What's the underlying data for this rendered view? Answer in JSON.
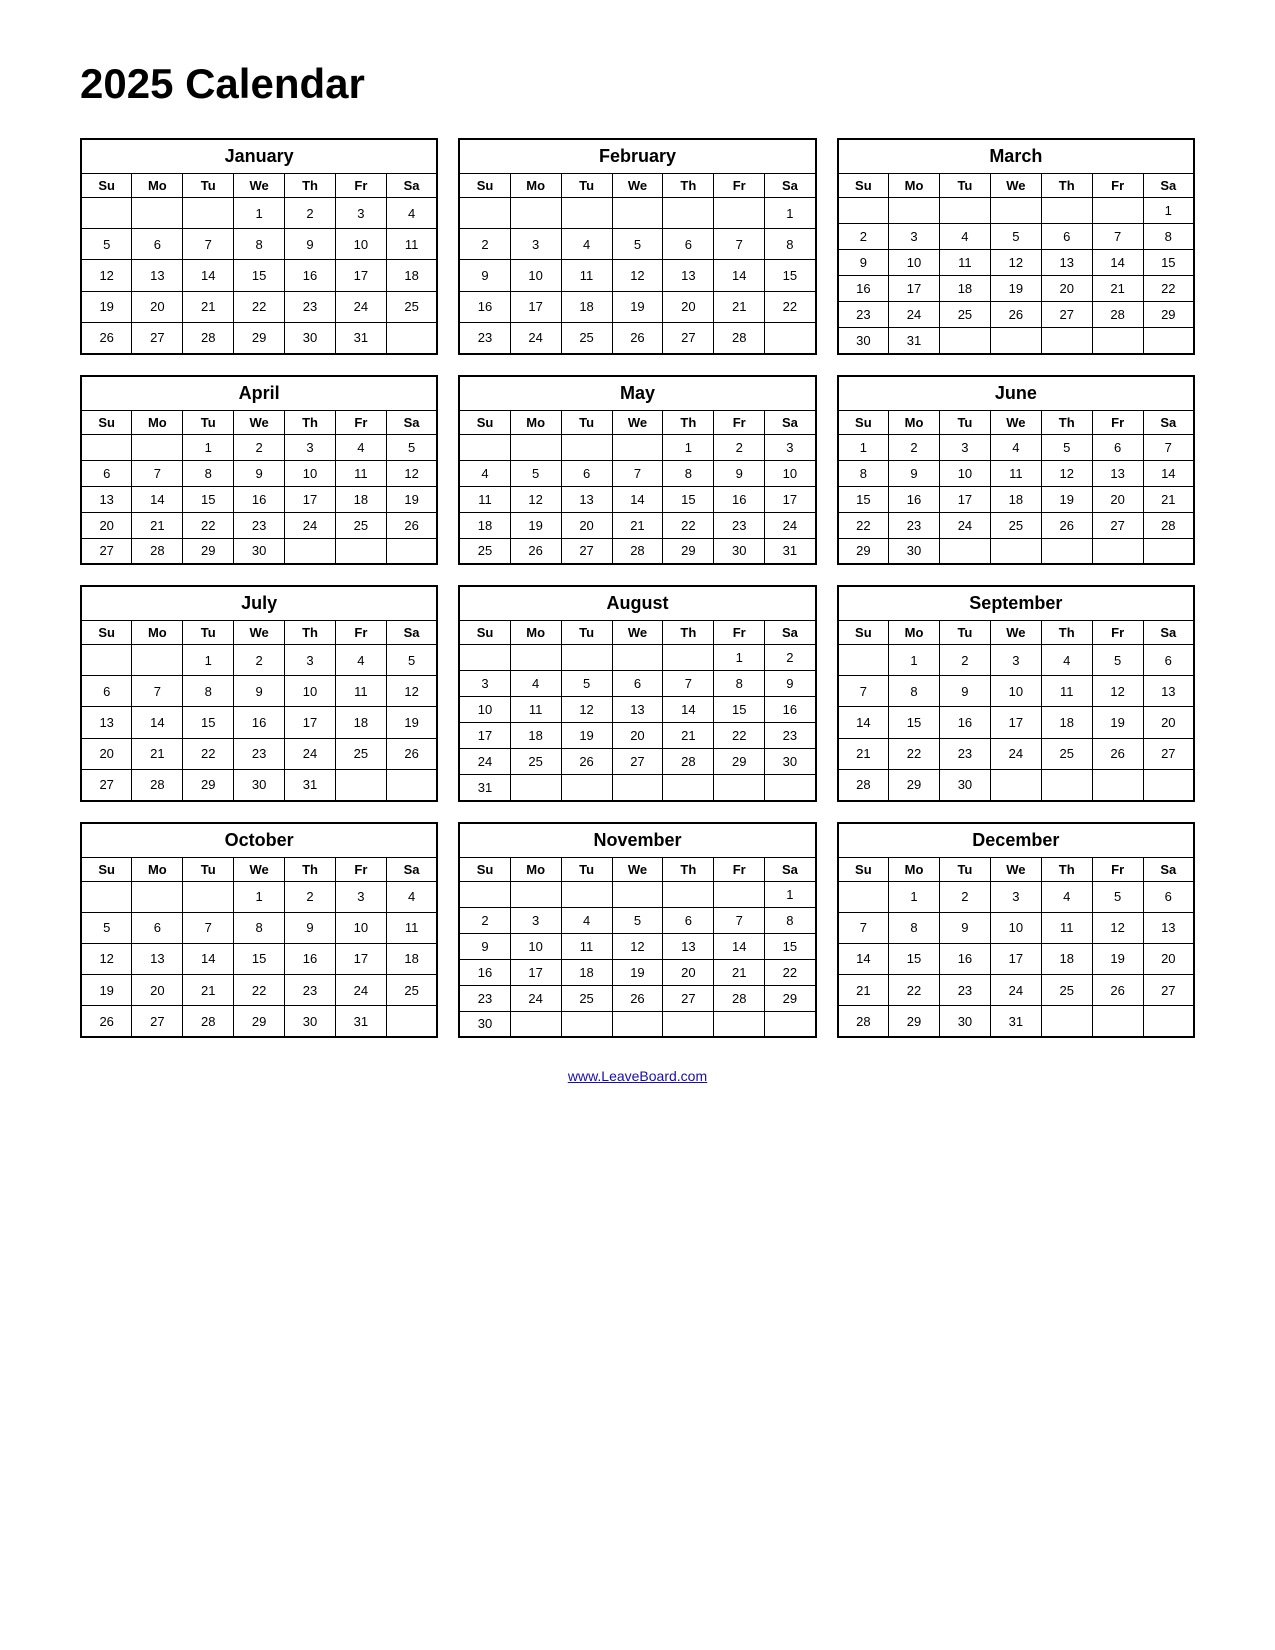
{
  "title": "2025 Calendar",
  "footer_link": "www.LeaveBoard.com",
  "days_header": [
    "Su",
    "Mo",
    "Tu",
    "We",
    "Th",
    "Fr",
    "Sa"
  ],
  "months": [
    {
      "name": "January",
      "weeks": [
        [
          "",
          "",
          "",
          "1",
          "2",
          "3",
          "4"
        ],
        [
          "5",
          "6",
          "7",
          "8",
          "9",
          "10",
          "11"
        ],
        [
          "12",
          "13",
          "14",
          "15",
          "16",
          "17",
          "18"
        ],
        [
          "19",
          "20",
          "21",
          "22",
          "23",
          "24",
          "25"
        ],
        [
          "26",
          "27",
          "28",
          "29",
          "30",
          "31",
          ""
        ]
      ]
    },
    {
      "name": "February",
      "weeks": [
        [
          "",
          "",
          "",
          "",
          "",
          "",
          "1"
        ],
        [
          "2",
          "3",
          "4",
          "5",
          "6",
          "7",
          "8"
        ],
        [
          "9",
          "10",
          "11",
          "12",
          "13",
          "14",
          "15"
        ],
        [
          "16",
          "17",
          "18",
          "19",
          "20",
          "21",
          "22"
        ],
        [
          "23",
          "24",
          "25",
          "26",
          "27",
          "28",
          ""
        ]
      ]
    },
    {
      "name": "March",
      "weeks": [
        [
          "",
          "",
          "",
          "",
          "",
          "",
          "1"
        ],
        [
          "2",
          "3",
          "4",
          "5",
          "6",
          "7",
          "8"
        ],
        [
          "9",
          "10",
          "11",
          "12",
          "13",
          "14",
          "15"
        ],
        [
          "16",
          "17",
          "18",
          "19",
          "20",
          "21",
          "22"
        ],
        [
          "23",
          "24",
          "25",
          "26",
          "27",
          "28",
          "29"
        ],
        [
          "30",
          "31",
          "",
          "",
          "",
          "",
          ""
        ]
      ]
    },
    {
      "name": "April",
      "weeks": [
        [
          "",
          "",
          "1",
          "2",
          "3",
          "4",
          "5"
        ],
        [
          "6",
          "7",
          "8",
          "9",
          "10",
          "11",
          "12"
        ],
        [
          "13",
          "14",
          "15",
          "16",
          "17",
          "18",
          "19"
        ],
        [
          "20",
          "21",
          "22",
          "23",
          "24",
          "25",
          "26"
        ],
        [
          "27",
          "28",
          "29",
          "30",
          "",
          "",
          ""
        ]
      ]
    },
    {
      "name": "May",
      "weeks": [
        [
          "",
          "",
          "",
          "",
          "1",
          "2",
          "3"
        ],
        [
          "4",
          "5",
          "6",
          "7",
          "8",
          "9",
          "10"
        ],
        [
          "11",
          "12",
          "13",
          "14",
          "15",
          "16",
          "17"
        ],
        [
          "18",
          "19",
          "20",
          "21",
          "22",
          "23",
          "24"
        ],
        [
          "25",
          "26",
          "27",
          "28",
          "29",
          "30",
          "31"
        ]
      ]
    },
    {
      "name": "June",
      "weeks": [
        [
          "1",
          "2",
          "3",
          "4",
          "5",
          "6",
          "7"
        ],
        [
          "8",
          "9",
          "10",
          "11",
          "12",
          "13",
          "14"
        ],
        [
          "15",
          "16",
          "17",
          "18",
          "19",
          "20",
          "21"
        ],
        [
          "22",
          "23",
          "24",
          "25",
          "26",
          "27",
          "28"
        ],
        [
          "29",
          "30",
          "",
          "",
          "",
          "",
          ""
        ]
      ]
    },
    {
      "name": "July",
      "weeks": [
        [
          "",
          "",
          "1",
          "2",
          "3",
          "4",
          "5"
        ],
        [
          "6",
          "7",
          "8",
          "9",
          "10",
          "11",
          "12"
        ],
        [
          "13",
          "14",
          "15",
          "16",
          "17",
          "18",
          "19"
        ],
        [
          "20",
          "21",
          "22",
          "23",
          "24",
          "25",
          "26"
        ],
        [
          "27",
          "28",
          "29",
          "30",
          "31",
          "",
          ""
        ]
      ]
    },
    {
      "name": "August",
      "weeks": [
        [
          "",
          "",
          "",
          "",
          "",
          "1",
          "2"
        ],
        [
          "3",
          "4",
          "5",
          "6",
          "7",
          "8",
          "9"
        ],
        [
          "10",
          "11",
          "12",
          "13",
          "14",
          "15",
          "16"
        ],
        [
          "17",
          "18",
          "19",
          "20",
          "21",
          "22",
          "23"
        ],
        [
          "24",
          "25",
          "26",
          "27",
          "28",
          "29",
          "30"
        ],
        [
          "31",
          "",
          "",
          "",
          "",
          "",
          ""
        ]
      ]
    },
    {
      "name": "September",
      "weeks": [
        [
          "",
          "1",
          "2",
          "3",
          "4",
          "5",
          "6"
        ],
        [
          "7",
          "8",
          "9",
          "10",
          "11",
          "12",
          "13"
        ],
        [
          "14",
          "15",
          "16",
          "17",
          "18",
          "19",
          "20"
        ],
        [
          "21",
          "22",
          "23",
          "24",
          "25",
          "26",
          "27"
        ],
        [
          "28",
          "29",
          "30",
          "",
          "",
          "",
          ""
        ]
      ]
    },
    {
      "name": "October",
      "weeks": [
        [
          "",
          "",
          "",
          "1",
          "2",
          "3",
          "4"
        ],
        [
          "5",
          "6",
          "7",
          "8",
          "9",
          "10",
          "11"
        ],
        [
          "12",
          "13",
          "14",
          "15",
          "16",
          "17",
          "18"
        ],
        [
          "19",
          "20",
          "21",
          "22",
          "23",
          "24",
          "25"
        ],
        [
          "26",
          "27",
          "28",
          "29",
          "30",
          "31",
          ""
        ]
      ]
    },
    {
      "name": "November",
      "weeks": [
        [
          "",
          "",
          "",
          "",
          "",
          "",
          "1"
        ],
        [
          "2",
          "3",
          "4",
          "5",
          "6",
          "7",
          "8"
        ],
        [
          "9",
          "10",
          "11",
          "12",
          "13",
          "14",
          "15"
        ],
        [
          "16",
          "17",
          "18",
          "19",
          "20",
          "21",
          "22"
        ],
        [
          "23",
          "24",
          "25",
          "26",
          "27",
          "28",
          "29"
        ],
        [
          "30",
          "",
          "",
          "",
          "",
          "",
          ""
        ]
      ]
    },
    {
      "name": "December",
      "weeks": [
        [
          "",
          "1",
          "2",
          "3",
          "4",
          "5",
          "6"
        ],
        [
          "7",
          "8",
          "9",
          "10",
          "11",
          "12",
          "13"
        ],
        [
          "14",
          "15",
          "16",
          "17",
          "18",
          "19",
          "20"
        ],
        [
          "21",
          "22",
          "23",
          "24",
          "25",
          "26",
          "27"
        ],
        [
          "28",
          "29",
          "30",
          "31",
          "",
          "",
          ""
        ]
      ]
    }
  ]
}
